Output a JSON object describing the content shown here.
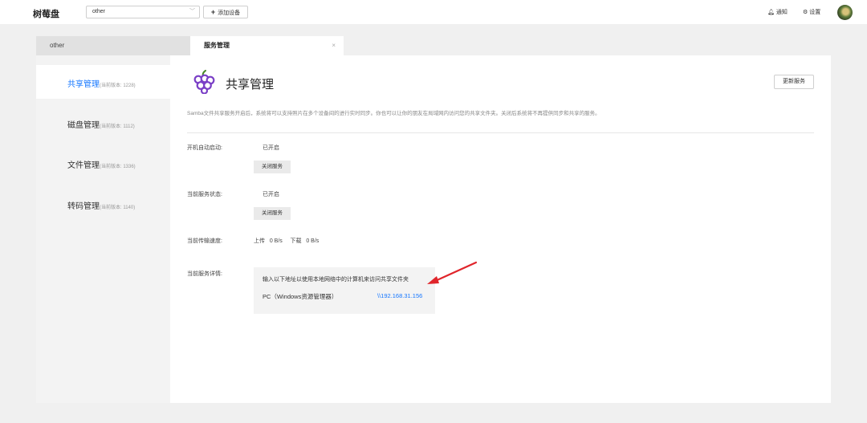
{
  "topbar": {
    "logo": "树莓盘",
    "device_select_value": "other",
    "add_device_plus": "+",
    "add_device_label": "添加设备",
    "notify_label": "通知",
    "settings_label": "设置"
  },
  "tabs": [
    {
      "label": "other"
    },
    {
      "label": "服务管理",
      "close": "×"
    }
  ],
  "sidebar": {
    "items": [
      {
        "name": "共享管理",
        "version": "(当前版本: 1228)",
        "active": true
      },
      {
        "name": "磁盘管理",
        "version": "(当前版本: 1112)",
        "active": false
      },
      {
        "name": "文件管理",
        "version": "(当前版本: 1336)",
        "active": false
      },
      {
        "name": "转码管理",
        "version": "(当前版本: 1140)",
        "active": false
      }
    ]
  },
  "main": {
    "title": "共享管理",
    "update_button": "更新服务",
    "description": "Samba文件共享服务开启后，系统将可以支持照片在多个设备间的进行实时同步。你也可以让你的朋友在局域网内访问您的共享文件夹。关闭后系统将不再提供同步和共享的服务。",
    "autostart_label": "开机自动启动:",
    "autostart_value": "已开启",
    "autostart_button": "关闭服务",
    "status_label": "当前服务状态:",
    "status_value": "已开启",
    "status_button": "关闭服务",
    "speed_label": "当前传输速度:",
    "speed_value": "上传   0 B/s     下载   0 B/s",
    "details_label": "当前服务详情:",
    "details_intro": "输入以下地址以使用本地网络中的计算机来访问共享文件夹",
    "pc_label": "PC（Windows资源管理器）",
    "pc_address": "\\\\192.168.31.156"
  },
  "colors": {
    "accent": "#1677ff",
    "grape": "#7a3fc6",
    "annotation_arrow": "#e0252b"
  },
  "icons": [
    "chevron-down-icon",
    "bell-icon",
    "gear-icon",
    "grape-icon",
    "close-icon",
    "red-arrow-annotation"
  ]
}
